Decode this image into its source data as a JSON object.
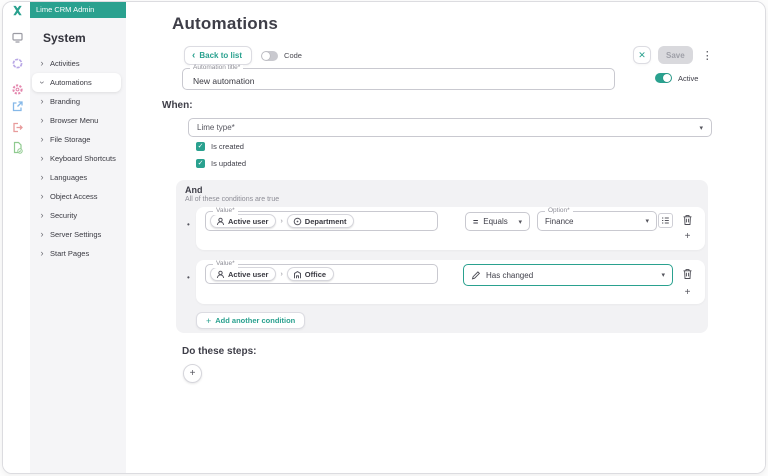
{
  "colors": {
    "accent_teal": "#2aa18f",
    "sidebar_bg": "#f5f5f7",
    "conditions_bg": "#f2f2f4",
    "disabled_button_bg": "#d9d9dd"
  },
  "glyphs": {
    "chevron": "›",
    "back_chevron": "‹",
    "close": "✕",
    "kebab": "⋮",
    "plus": "+",
    "dropdown_arrow": "▾",
    "equals": "=",
    "check": "✓",
    "bullet": "•"
  },
  "app_header": {
    "title": "Lime CRM Admin"
  },
  "sidebar": {
    "heading": "System",
    "items": [
      {
        "label": "Activities"
      },
      {
        "label": "Automations",
        "selected": true,
        "expanded": true
      },
      {
        "label": "Branding"
      },
      {
        "label": "Browser Menu"
      },
      {
        "label": "File Storage"
      },
      {
        "label": "Keyboard Shortcuts"
      },
      {
        "label": "Languages"
      },
      {
        "label": "Object Access"
      },
      {
        "label": "Security"
      },
      {
        "label": "Server Settings"
      },
      {
        "label": "Start Pages"
      }
    ]
  },
  "page": {
    "title": "Automations"
  },
  "toolbar": {
    "back_label": "Back to list",
    "code_label": "Code",
    "code_on": false,
    "save_label": "Save",
    "save_enabled": false
  },
  "title_field": {
    "label": "Automation title*",
    "value": "New automation"
  },
  "active_toggle": {
    "label": "Active",
    "on": true
  },
  "when_section": {
    "heading": "When:",
    "type_placeholder": "Lime type*",
    "checkboxes": [
      {
        "label": "Is created",
        "checked": true
      },
      {
        "label": "Is updated",
        "checked": true
      }
    ]
  },
  "conditions_section": {
    "heading": "And",
    "subheading": "All of these conditions are true",
    "add_button_label": "Add another condition",
    "rows": [
      {
        "value_label": "Value*",
        "chips": [
          {
            "label": "Active user"
          },
          {
            "label": "Department"
          }
        ],
        "operator_label": "Equals",
        "option_label": "Option*",
        "option_value": "Finance"
      },
      {
        "value_label": "Value*",
        "chips": [
          {
            "label": "Active user"
          },
          {
            "label": "Office"
          }
        ],
        "operator_label": "Has changed",
        "focused": true
      }
    ]
  },
  "steps_section": {
    "heading": "Do these steps:"
  }
}
